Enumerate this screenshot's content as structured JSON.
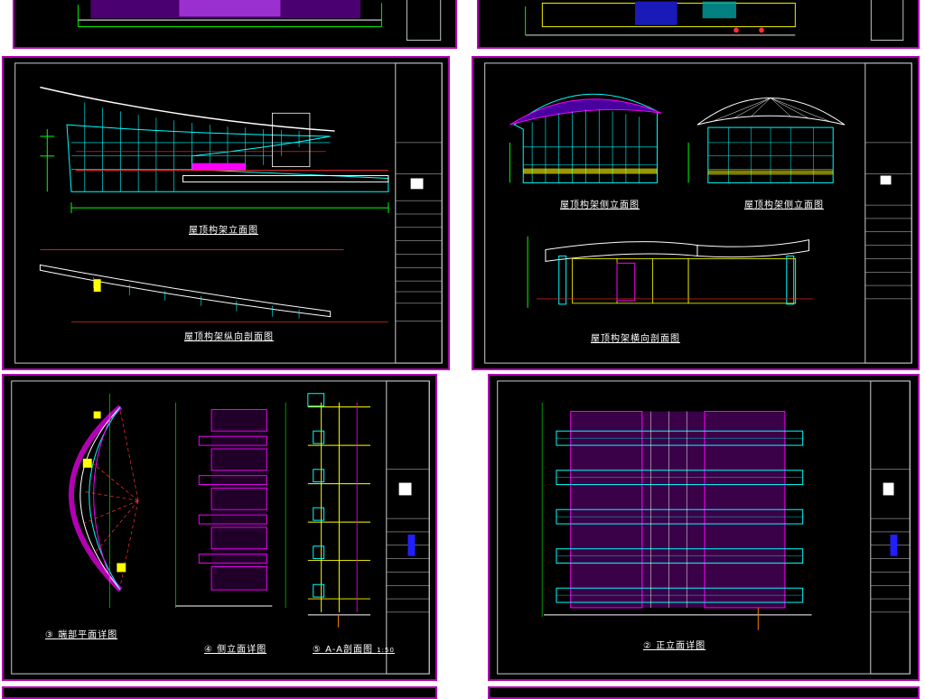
{
  "drawing_titles": {
    "roof_frame_side_elevation": "屋顶构架立面图",
    "roof_frame_longitudinal_section": "屋顶构架纵向剖面图",
    "roof_frame_side_elevation_2": "屋顶构架侧立面图",
    "roof_frame_back_elevation": "屋顶构架侧立面图",
    "roof_frame_cross_section": "屋顶构架横向剖面图",
    "end_plan_detail": "端部平面详图",
    "side_elevation_detail": "侧立面详图",
    "aa_section_detail": "A-A剖面图",
    "front_elevation_detail": "正立面详图"
  },
  "labels": {
    "detail_number_3": "③",
    "detail_number_4": "④",
    "detail_number_5": "⑤",
    "detail_number_2": "②",
    "scale_note": "1:50"
  },
  "colors": {
    "sheet_border": "#b400b4",
    "background": "#000000",
    "cyan": "#00ffff",
    "magenta": "#ff00ff",
    "yellow": "#ffff00",
    "red": "#ff0000",
    "white": "#ffffff"
  }
}
